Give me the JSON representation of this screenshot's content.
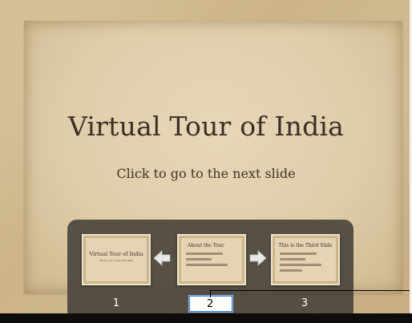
{
  "slide": {
    "title": "Virtual Tour of India",
    "subtitle": "Click to go to the next slide"
  },
  "navigator": {
    "thumbnails": [
      {
        "number": "1",
        "title": "Virtual Tour of India",
        "subtitle": "Click to go to the next slide"
      },
      {
        "number": "2",
        "title": "About the Tour"
      },
      {
        "number": "3",
        "title": "This is the Third Slide"
      }
    ],
    "prev_arrow_icon": "arrow-left-icon",
    "next_arrow_icon": "arrow-right-icon",
    "page_input_value": "2"
  },
  "colors": {
    "panel": "#48423a",
    "input_border": "#3a7bd5",
    "title_text": "#3b2f26"
  }
}
